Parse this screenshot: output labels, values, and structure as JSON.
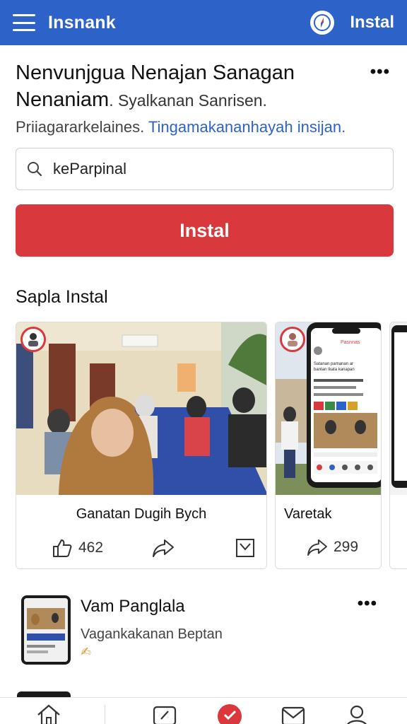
{
  "header": {
    "app_name": "Insnank",
    "install_label": "Instal",
    "icons": [
      "menu-icon",
      "compass-icon"
    ]
  },
  "intro": {
    "title_line1": "Nenvunjgua Nenajan Sanagan",
    "title_line2": "Nenaniam",
    "title_line2_sub": ". Syalkanan Sanrisen.",
    "meta_text": "Priiagararkelaines.",
    "meta_link": "Tingamakananhayah insijan."
  },
  "search": {
    "value": "keParpinal"
  },
  "install_button": {
    "label": "Instal"
  },
  "section": {
    "title": "Sapla Instal"
  },
  "cards": [
    {
      "caption": "Ganatan Dugih Bych",
      "likes": "462"
    },
    {
      "caption": "Varetak",
      "shares": "299",
      "phone_header": "Pasnnas",
      "phone_text": "Satanan pamanan ar bantan Ikata kanapan"
    }
  ],
  "list_item": {
    "title": "Vam Panglala",
    "subtitle": "Vagankakanan Beptan",
    "emoji": "✍"
  },
  "colors": {
    "header_bg": "#2d63c8",
    "install_red": "#d9393c",
    "link_blue": "#2d63c8"
  }
}
